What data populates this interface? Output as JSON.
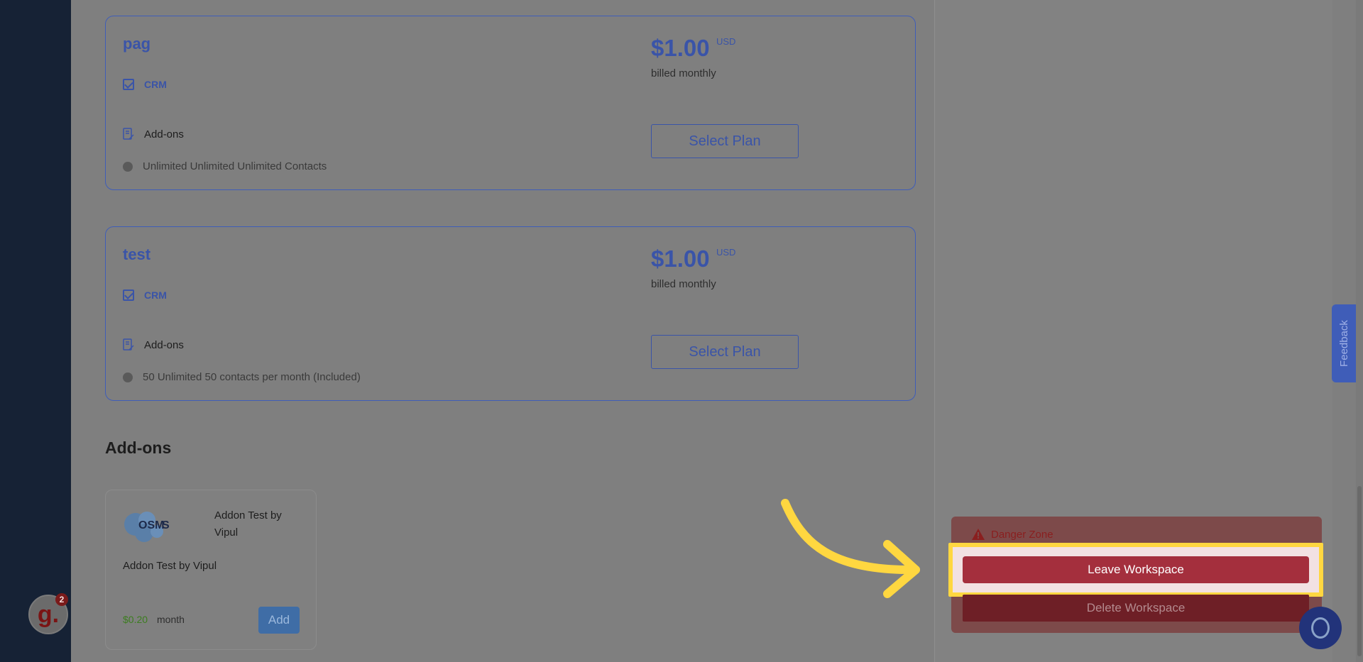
{
  "plans": [
    {
      "name": "pag",
      "feature": "CRM",
      "addons_label": "Add-ons",
      "contacts_text": "Unlimited Unlimited Unlimited Contacts",
      "price": "$1.00",
      "currency": "USD",
      "billing": "billed monthly",
      "select_label": "Select Plan"
    },
    {
      "name": "test",
      "feature": "CRM",
      "addons_label": "Add-ons",
      "contacts_text": "50 Unlimited 50 contacts per month (Included)",
      "price": "$1.00",
      "currency": "USD",
      "billing": "billed monthly",
      "select_label": "Select Plan"
    }
  ],
  "addons_section": {
    "heading": "Add-ons",
    "items": [
      {
        "logo_alt": "Osmos",
        "title": "Addon Test by Vipul",
        "description": "Addon Test by Vipul",
        "price": "$0.20",
        "period": "month",
        "add_label": "Add"
      }
    ]
  },
  "danger_zone": {
    "label": "Danger Zone",
    "leave_label": "Leave Workspace",
    "delete_label": "Delete Workspace"
  },
  "feedback": {
    "label": "Feedback"
  },
  "widget": {
    "letter": "g.",
    "badge_count": "2"
  },
  "icons": {
    "checkbox": "checkbox-checked-icon",
    "addons": "document-edit-icon",
    "contacts": "dot-icon",
    "danger": "warning-icon",
    "chat": "chat-bubble-icon",
    "arrow": "curved-arrow-icon"
  },
  "colors": {
    "accent": "#3f5db8",
    "danger": "#a42f3d",
    "highlight": "#ffd740",
    "sidebar": "#162235"
  }
}
